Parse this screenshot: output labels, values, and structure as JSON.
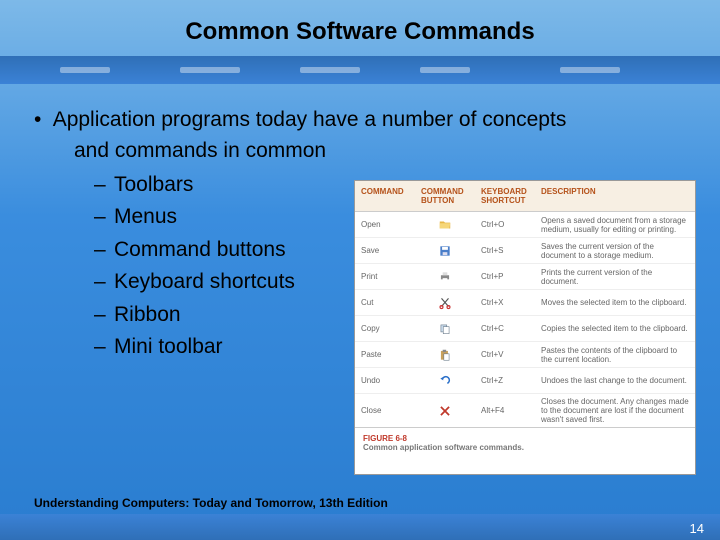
{
  "title": "Common Software Commands",
  "lead_bullet": "•",
  "lead_text_1": "Application programs today have a number of concepts",
  "lead_text_2": "and commands in common",
  "sub_items": {
    "i0": "Toolbars",
    "i1": "Menus",
    "i2": "Command buttons",
    "i3": "Keyboard shortcuts",
    "i4": "Ribbon",
    "i5": "Mini toolbar"
  },
  "sub_dash": "–",
  "figure": {
    "headers": {
      "h0": "COMMAND",
      "h1": "COMMAND BUTTON",
      "h2": "KEYBOARD SHORTCUT",
      "h3": "DESCRIPTION"
    },
    "rows": {
      "r0": {
        "cmd": "Open",
        "key": "Ctrl+O",
        "desc": "Opens a saved document from a storage medium, usually for editing or printing."
      },
      "r1": {
        "cmd": "Save",
        "key": "Ctrl+S",
        "desc": "Saves the current version of the document to a storage medium."
      },
      "r2": {
        "cmd": "Print",
        "key": "Ctrl+P",
        "desc": "Prints the current version of the document."
      },
      "r3": {
        "cmd": "Cut",
        "key": "Ctrl+X",
        "desc": "Moves the selected item to the clipboard."
      },
      "r4": {
        "cmd": "Copy",
        "key": "Ctrl+C",
        "desc": "Copies the selected item to the clipboard."
      },
      "r5": {
        "cmd": "Paste",
        "key": "Ctrl+V",
        "desc": "Pastes the contents of the clipboard to the current location."
      },
      "r6": {
        "cmd": "Undo",
        "key": "Ctrl+Z",
        "desc": "Undoes the last change to the document."
      },
      "r7": {
        "cmd": "Close",
        "key": "Alt+F4",
        "desc": "Closes the document. Any changes made to the document are lost if the document wasn't saved first."
      }
    },
    "caption_num": "FIGURE 6-8",
    "caption_text": "Common application software commands."
  },
  "footer": {
    "book": "Understanding Computers: Today and Tomorrow, 13th Edition",
    "page": "14"
  }
}
